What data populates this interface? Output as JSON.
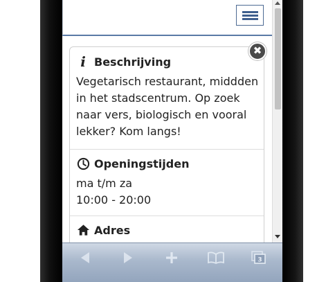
{
  "header": {
    "menu_icon": "hamburger-menu-icon"
  },
  "card": {
    "close_icon": "close-icon",
    "description": {
      "icon": "info-icon",
      "heading": "Beschrijving",
      "lines": [
        "Vegetarisch restaurant, middden",
        "in het stadscentrum. Op zoek",
        "naar vers, biologisch en vooral",
        "lekker? Kom langs!"
      ]
    },
    "opening_hours": {
      "icon": "clock-icon",
      "heading": "Openingstijden",
      "days": "ma t/m za",
      "hours": "10:00 - 20:00"
    },
    "address": {
      "icon": "home-icon",
      "heading": "Adres"
    }
  },
  "toolbar": {
    "items": [
      "back-icon",
      "forward-icon",
      "add-icon",
      "bookmarks-icon",
      "tabs-icon"
    ],
    "tab_count": "3"
  },
  "colors": {
    "header_border": "#5a7aa6",
    "toolbar_top": "#cfd8e4",
    "toolbar_bottom": "#93a5bd"
  }
}
